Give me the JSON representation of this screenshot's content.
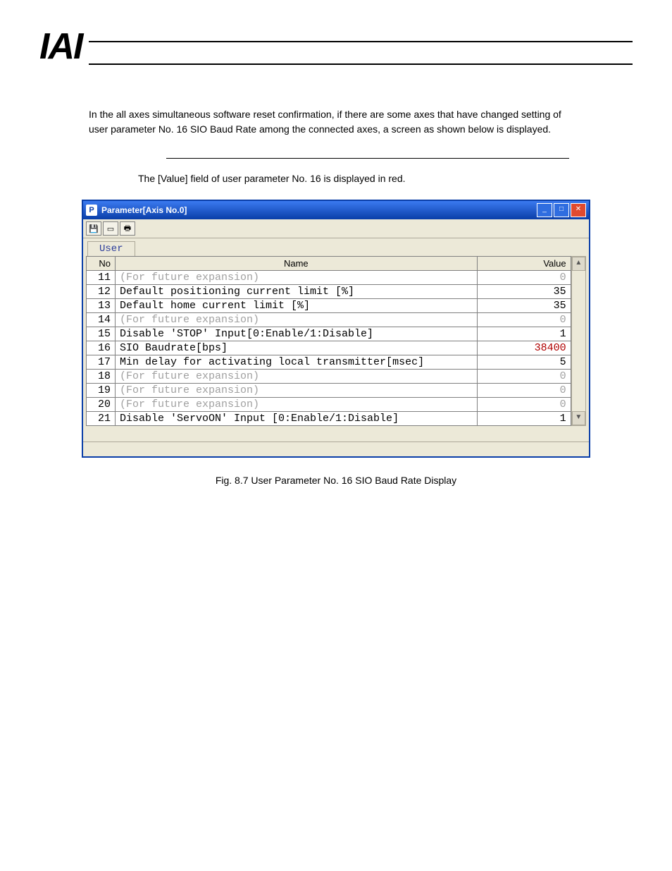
{
  "logo_text": "IAI",
  "paragraph": "In the all axes simultaneous software reset confirmation, if there are some axes that have changed setting of user parameter No. 16 SIO Baud Rate among the connected axes, a screen as shown below is displayed.",
  "indent_note": "The [Value] field of user parameter No. 16 is displayed in red.",
  "window": {
    "title": "Parameter[Axis No.0]",
    "tab": "User",
    "toolbar_icons": [
      "save",
      "window",
      "print"
    ],
    "columns": [
      "No",
      "Name",
      "Value"
    ],
    "rows": [
      {
        "no": "11",
        "name": "(For future expansion)",
        "value": "0",
        "dim": true
      },
      {
        "no": "12",
        "name": "Default positioning current limit [%]",
        "value": "35"
      },
      {
        "no": "13",
        "name": "Default home current limit [%]",
        "value": "35"
      },
      {
        "no": "14",
        "name": "(For future expansion)",
        "value": "0",
        "dim": true
      },
      {
        "no": "15",
        "name": "Disable 'STOP' Input[0:Enable/1:Disable]",
        "value": "1"
      },
      {
        "no": "16",
        "name": "SIO Baudrate[bps]",
        "value": "38400",
        "red": true
      },
      {
        "no": "17",
        "name": "Min delay for activating local transmitter[msec]",
        "value": "5"
      },
      {
        "no": "18",
        "name": "(For future expansion)",
        "value": "0",
        "dim": true
      },
      {
        "no": "19",
        "name": "(For future expansion)",
        "value": "0",
        "dim": true
      },
      {
        "no": "20",
        "name": "(For future expansion)",
        "value": "0",
        "dim": true
      },
      {
        "no": "21",
        "name": "Disable 'ServoON' Input [0:Enable/1:Disable]",
        "value": "1"
      }
    ],
    "winbtns": {
      "min": "_",
      "max": "□",
      "close": "✕"
    },
    "scroll_up": "▲",
    "scroll_down": "▼"
  },
  "figure_caption": "Fig. 8.7 User Parameter No. 16 SIO Baud Rate Display"
}
